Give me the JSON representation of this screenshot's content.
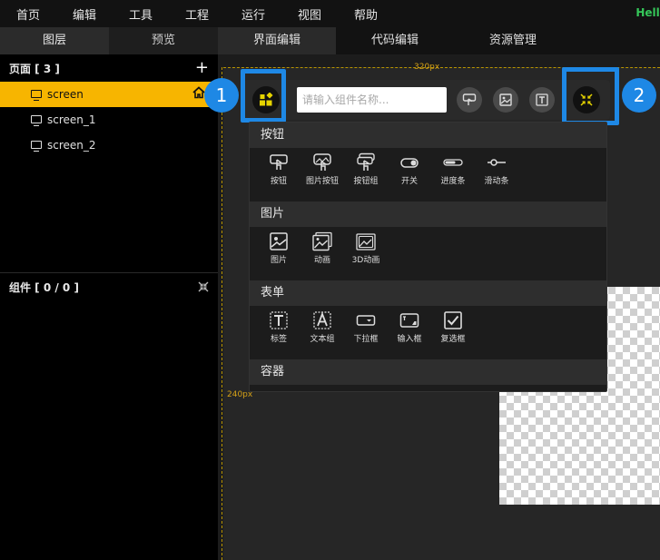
{
  "menubar": {
    "items": [
      "首页",
      "编辑",
      "工具",
      "工程",
      "运行",
      "视图",
      "帮助"
    ],
    "right_text": "Hello"
  },
  "left_panel": {
    "tabs": [
      "图层",
      "预览"
    ],
    "pages_header": "页面 [ 3 ]",
    "pages": [
      "screen",
      "screen_1",
      "screen_2"
    ],
    "components_header": "组件 [ 0 / 0 ]"
  },
  "editor_tabs": [
    "界面编辑",
    "代码编辑",
    "资源管理"
  ],
  "canvas": {
    "ruler_top_label": "320px",
    "ruler_left_label": "240px"
  },
  "toolbar": {
    "search_placeholder": "请输入组件名称..."
  },
  "callouts": [
    "1",
    "2"
  ],
  "widget_groups": [
    {
      "title": "按钮",
      "items": [
        {
          "label": "按钮",
          "icon": "button-icon"
        },
        {
          "label": "图片按钮",
          "icon": "image-button-icon"
        },
        {
          "label": "按钮组",
          "icon": "button-group-icon"
        },
        {
          "label": "开关",
          "icon": "switch-icon"
        },
        {
          "label": "进度条",
          "icon": "progress-bar-icon"
        },
        {
          "label": "滑动条",
          "icon": "slider-icon"
        }
      ]
    },
    {
      "title": "图片",
      "items": [
        {
          "label": "图片",
          "icon": "image-icon"
        },
        {
          "label": "动画",
          "icon": "animation-icon"
        },
        {
          "label": "3D动画",
          "icon": "3d-animation-icon"
        }
      ]
    },
    {
      "title": "表单",
      "items": [
        {
          "label": "标签",
          "icon": "label-icon"
        },
        {
          "label": "文本组",
          "icon": "text-group-icon"
        },
        {
          "label": "下拉框",
          "icon": "dropdown-icon"
        },
        {
          "label": "输入框",
          "icon": "input-icon"
        },
        {
          "label": "复选框",
          "icon": "checkbox-icon"
        }
      ]
    },
    {
      "title": "容器",
      "items": []
    }
  ],
  "colors": {
    "accent": "#f7b500",
    "highlight": "#1e88e5",
    "hello": "#35c759"
  }
}
